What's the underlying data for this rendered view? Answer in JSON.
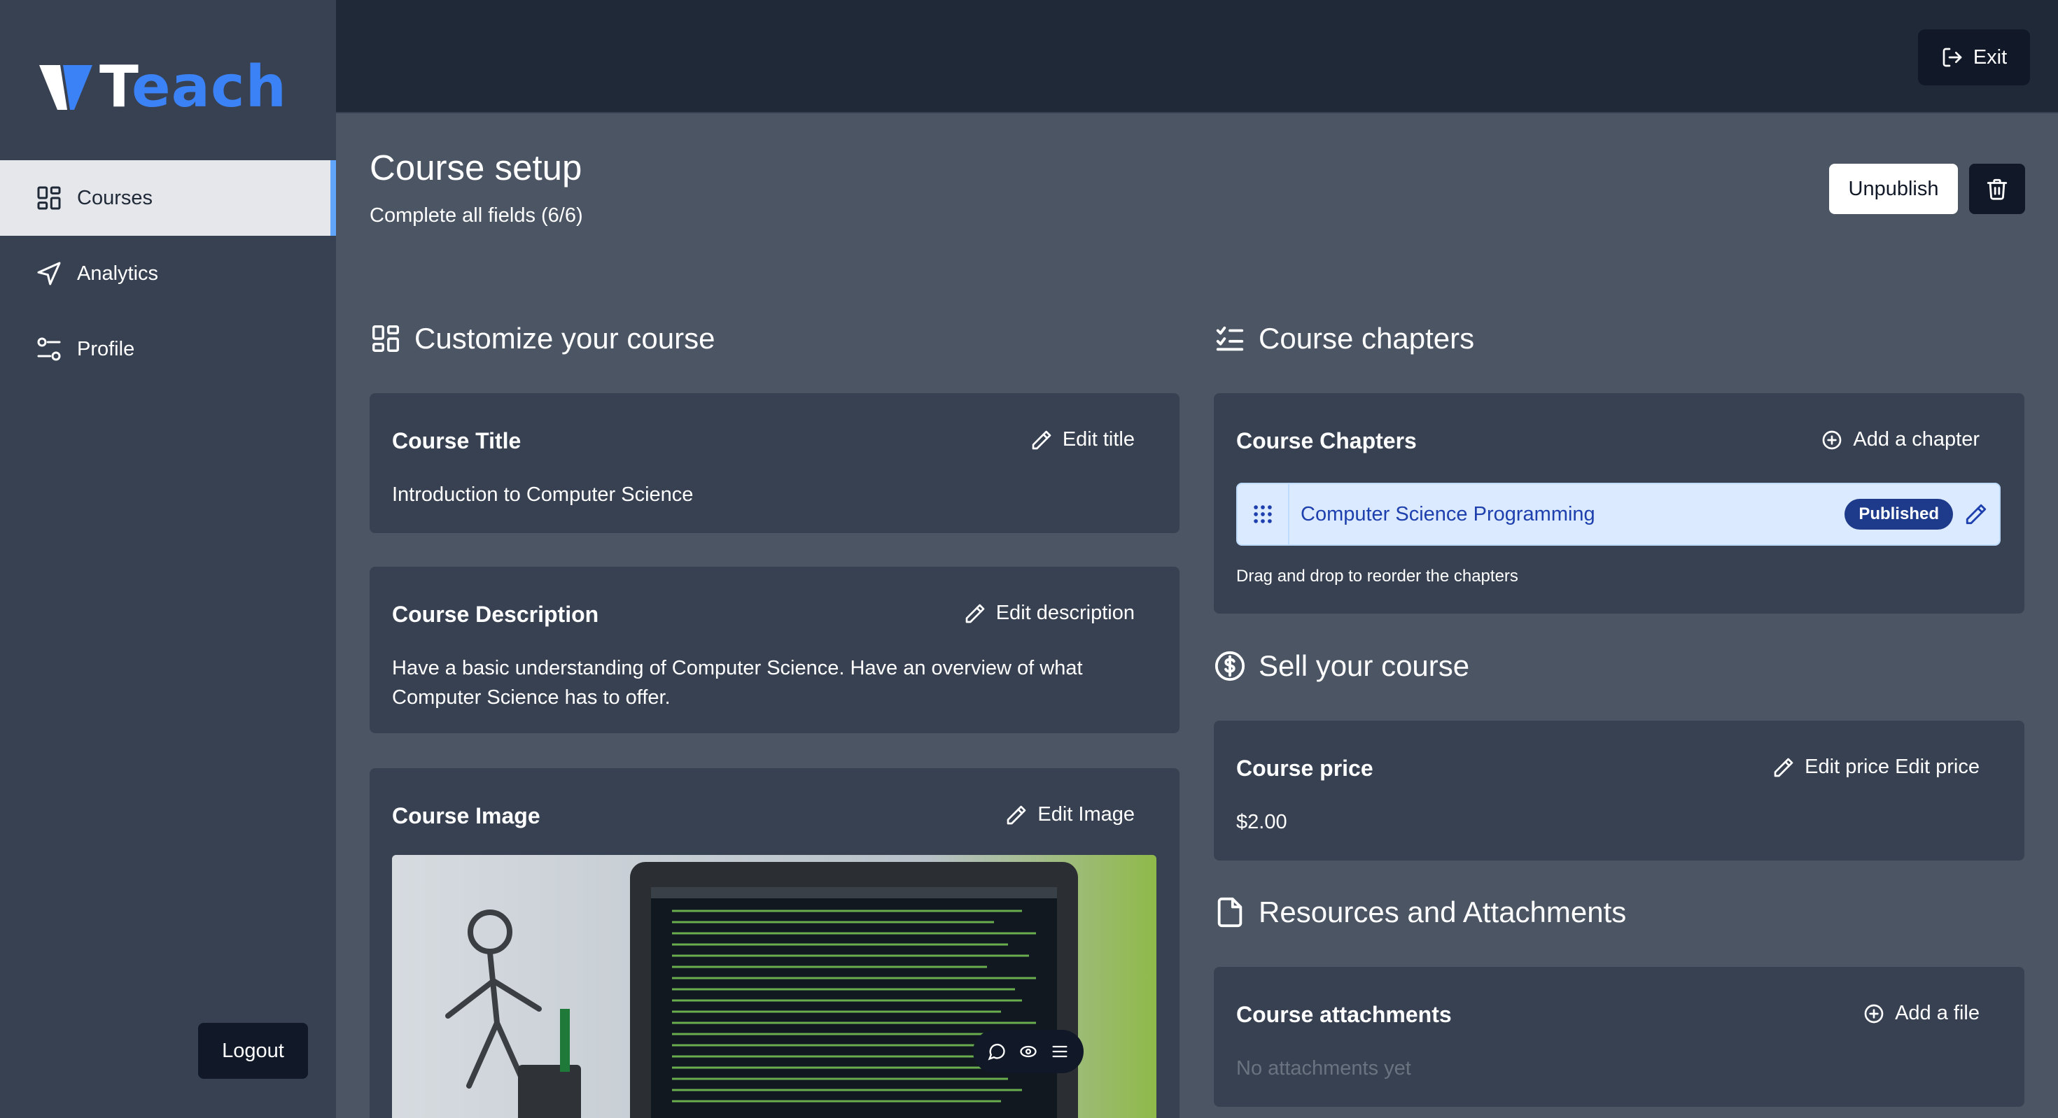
{
  "brand": {
    "logo_text_first": "T",
    "logo_text_rest": "each"
  },
  "sidebar": {
    "items": [
      {
        "label": "Courses",
        "icon": "layout-grid-icon",
        "active": true
      },
      {
        "label": "Analytics",
        "icon": "send-icon",
        "active": false
      },
      {
        "label": "Profile",
        "icon": "sliders-icon",
        "active": false
      }
    ],
    "logout_label": "Logout"
  },
  "header": {
    "exit_label": "Exit"
  },
  "page": {
    "title": "Course setup",
    "subtitle": "Complete all fields (6/6)",
    "unpublish_label": "Unpublish"
  },
  "customize": {
    "heading": "Customize your course",
    "title_card": {
      "label": "Course Title",
      "action": "Edit title",
      "value": "Introduction to Computer Science"
    },
    "description_card": {
      "label": "Course Description",
      "action": "Edit description",
      "value": "Have a basic understanding of Computer Science. Have an overview of what Computer Science has to offer."
    },
    "image_card": {
      "label": "Course Image",
      "action": "Edit Image"
    }
  },
  "chapters": {
    "heading": "Course chapters",
    "card_label": "Course Chapters",
    "add_label": "Add a chapter",
    "items": [
      {
        "title": "Computer Science Programming",
        "status": "Published"
      }
    ],
    "hint": "Drag and drop to reorder the chapters"
  },
  "sell": {
    "heading": "Sell your course",
    "card_label": "Course price",
    "action": "Edit price Edit price",
    "value": "$2.00"
  },
  "resources": {
    "heading": "Resources and Attachments",
    "card_label": "Course attachments",
    "add_label": "Add a file",
    "empty_text": "No attachments yet"
  },
  "colors": {
    "accent": "#3b82f6",
    "sidebar_bg": "#374151",
    "main_bg": "#4b5563",
    "card_bg": "#374151",
    "badge_bg": "#1e3a8a"
  }
}
